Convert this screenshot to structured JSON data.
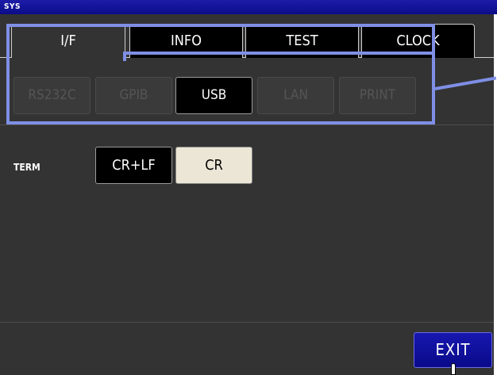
{
  "titlebar": {
    "title": "SYS"
  },
  "tabs": [
    {
      "label": "I/F",
      "active": true
    },
    {
      "label": "INFO",
      "active": false
    },
    {
      "label": "TEST",
      "active": false
    },
    {
      "label": "CLOCK",
      "active": false
    }
  ],
  "interfaces": [
    {
      "label": "RS232C",
      "selected": false
    },
    {
      "label": "GPIB",
      "selected": false
    },
    {
      "label": "USB",
      "selected": true
    },
    {
      "label": "LAN",
      "selected": false
    },
    {
      "label": "PRINT",
      "selected": false
    }
  ],
  "term": {
    "label": "TERM",
    "options": [
      {
        "label": "CR+LF",
        "selected": true
      },
      {
        "label": "CR",
        "selected": false
      }
    ]
  },
  "exit_label": "EXIT",
  "colors": {
    "accent": "#1717b0",
    "highlight": "#7f8fe6",
    "background": "#333333",
    "selected_button": "#000000",
    "unselected_term": "#ece6d6"
  }
}
